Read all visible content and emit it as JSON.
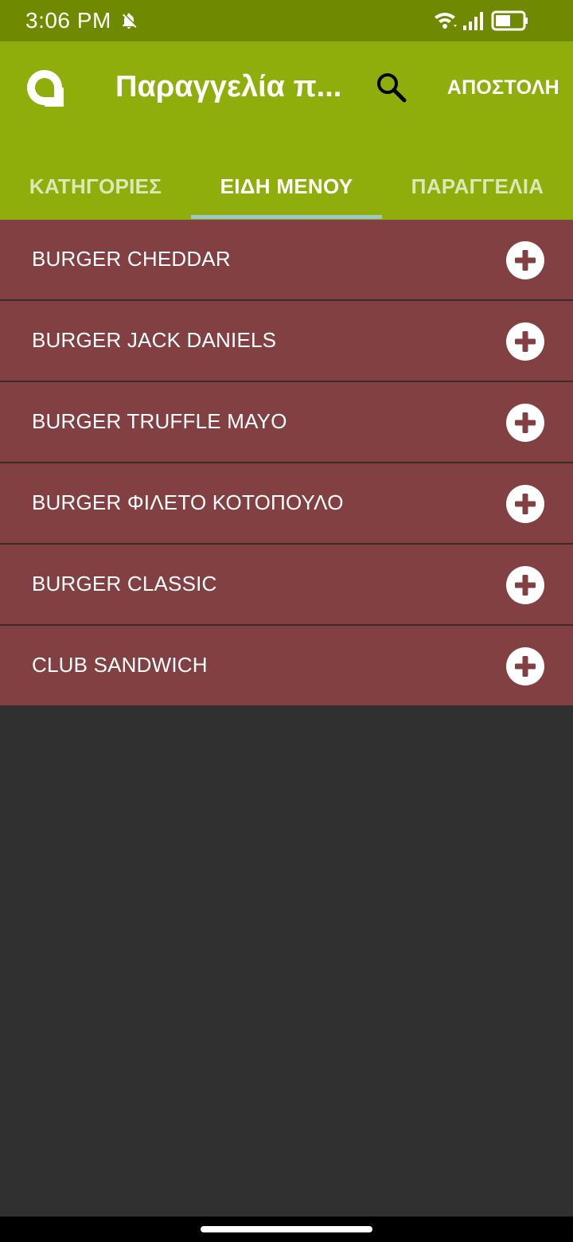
{
  "status_bar": {
    "time": "3:06 PM"
  },
  "app_bar": {
    "title": "Παραγγελία π...",
    "send_label": "ΑΠΟΣΤΟΛΗ"
  },
  "tabs": [
    {
      "label": "ΚΑΤΗΓΟΡΙΕΣ",
      "active": false
    },
    {
      "label": "ΕΙΔΗ ΜΕΝΟΥ",
      "active": true
    },
    {
      "label": "ΠΑΡΑΓΓΕΛΙΑ",
      "active": false
    }
  ],
  "menu_items": [
    {
      "label": "BURGER CHEDDAR"
    },
    {
      "label": "BURGER JACK DANIELS"
    },
    {
      "label": "BURGER TRUFFLE MAYO"
    },
    {
      "label": "BURGER ΦΙΛΕΤΟ ΚΟΤΟΠΟΥΛΟ"
    },
    {
      "label": "BURGER CLASSIC"
    },
    {
      "label": "CLUB SANDWICH"
    }
  ],
  "icons": {
    "logo": "app-logo-icon",
    "search": "search-icon",
    "add": "add-circle-icon",
    "bell_off": "bell-off-icon",
    "wifi": "wifi-icon",
    "signal": "signal-icon",
    "battery": "battery-icon"
  },
  "colors": {
    "status_bar": "#6f8a00",
    "app_bar": "#8fae0c",
    "tab_indicator": "#9ec6cf",
    "item_background": "#824043",
    "page_background": "#303030"
  }
}
